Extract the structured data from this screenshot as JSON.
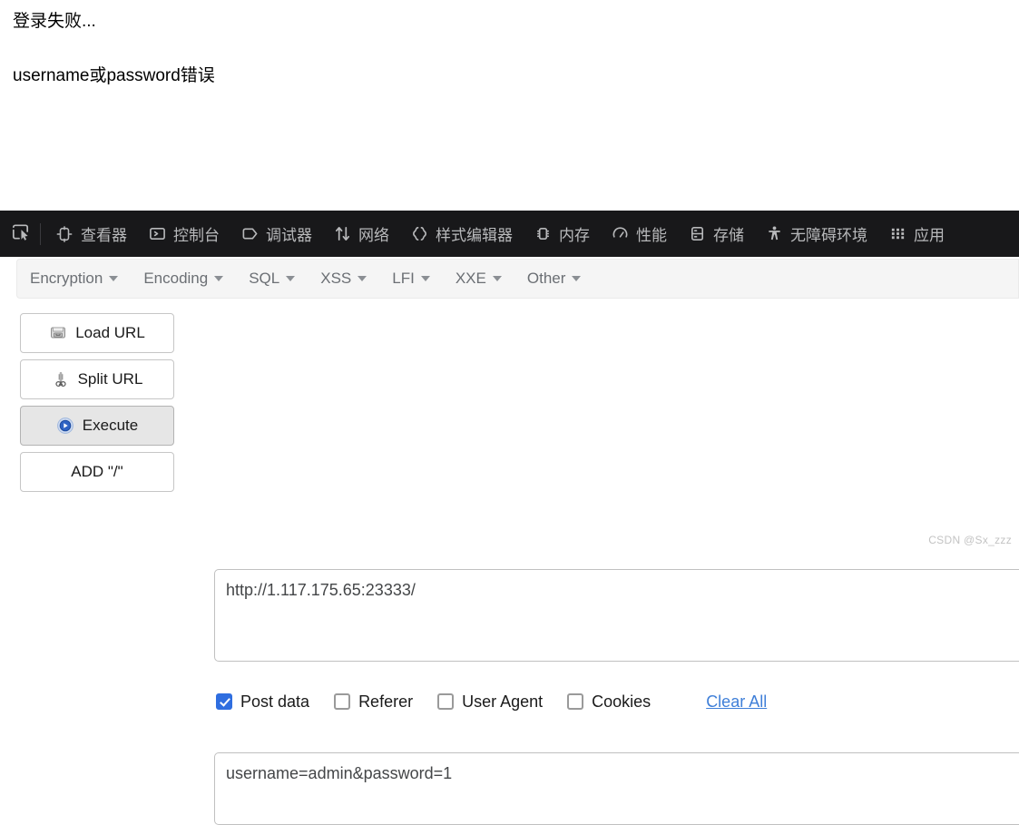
{
  "page": {
    "line1": "登录失败...",
    "line2": "username或password错误"
  },
  "devtools": {
    "picker_icon": "element-picker-icon",
    "tabs": [
      {
        "label": "查看器",
        "icon": "inspector-icon"
      },
      {
        "label": "控制台",
        "icon": "console-icon"
      },
      {
        "label": "调试器",
        "icon": "debugger-icon"
      },
      {
        "label": "网络",
        "icon": "network-icon"
      },
      {
        "label": "样式编辑器",
        "icon": "style-editor-icon"
      },
      {
        "label": "内存",
        "icon": "memory-icon"
      },
      {
        "label": "性能",
        "icon": "performance-icon"
      },
      {
        "label": "存储",
        "icon": "storage-icon"
      },
      {
        "label": "无障碍环境",
        "icon": "accessibility-icon"
      },
      {
        "label": "应用",
        "icon": "application-icon"
      }
    ]
  },
  "hackbar": {
    "menu": [
      {
        "label": "Encryption"
      },
      {
        "label": "Encoding"
      },
      {
        "label": "SQL"
      },
      {
        "label": "XSS"
      },
      {
        "label": "LFI"
      },
      {
        "label": "XXE"
      },
      {
        "label": "Other"
      }
    ],
    "buttons": [
      {
        "label": "Load URL",
        "icon": "disk-url-icon",
        "pressed": false
      },
      {
        "label": "Split URL",
        "icon": "scissors-icon",
        "pressed": false
      },
      {
        "label": "Execute",
        "icon": "play-icon",
        "pressed": true
      },
      {
        "label": "ADD \"/\"",
        "icon": "none",
        "pressed": false
      }
    ],
    "url_field": {
      "value": "http://1.117.175.65:23333/",
      "placeholder": "URL"
    },
    "options": [
      {
        "label": "Post data",
        "checked": true
      },
      {
        "label": "Referer",
        "checked": false
      },
      {
        "label": "User Agent",
        "checked": false
      },
      {
        "label": "Cookies",
        "checked": false
      }
    ],
    "clear_all_label": "Clear All",
    "postdata_field": {
      "value": "username=admin&password=1",
      "placeholder": "Post data"
    }
  },
  "watermark": "CSDN @Sx_zzz",
  "colors": {
    "devtools_bg": "#18181a",
    "devtools_text": "#b8b9bb",
    "accent_blue": "#2f6ee0",
    "link_blue": "#3f7fd8",
    "panel_bg": "#f5f5f5"
  }
}
